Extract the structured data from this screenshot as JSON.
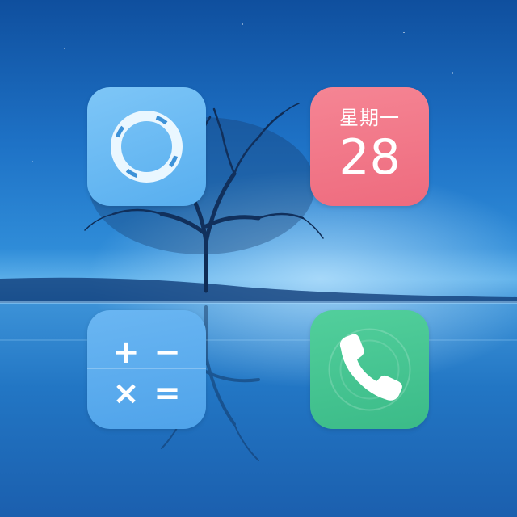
{
  "home_screen": {
    "apps": [
      {
        "name": "browser",
        "icon": "browser-ring-icon",
        "color": "#5cb2f0"
      },
      {
        "name": "calendar",
        "icon": "calendar-icon",
        "color": "#f0717f",
        "weekday": "星期一",
        "day": "28"
      },
      {
        "name": "calculator",
        "icon": "calculator-icon",
        "color": "#56a8ed",
        "symbols": [
          "+",
          "−",
          "×",
          "="
        ]
      },
      {
        "name": "phone",
        "icon": "phone-handset-icon",
        "color": "#44c38f"
      }
    ],
    "wallpaper": {
      "icon": "lone-tree-lake-wallpaper",
      "sky_color": "#1e72c6",
      "water_color": "#2a83cf"
    }
  }
}
